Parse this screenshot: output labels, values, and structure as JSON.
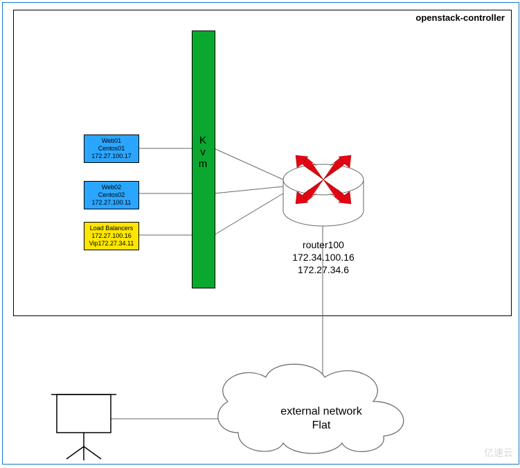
{
  "title": "openstack-controller",
  "kvm_label": "K\nv\nm",
  "nodes": {
    "web01": {
      "name": "Web01",
      "os": "Centos01",
      "ip": "172.27.100.17"
    },
    "web02": {
      "name": "Web02",
      "os": "Centos02",
      "ip": "172.27.100.11"
    },
    "lb": {
      "name": "Load Balancers",
      "ip": "172.27.100.16",
      "vip": "Vip172.27.34.11"
    }
  },
  "router": {
    "name": "router100",
    "ip1": "172.34.100.16",
    "ip2": "172.27.34.6"
  },
  "external": {
    "line1": "external  network",
    "line2": "Flat"
  },
  "watermark": "亿速云"
}
